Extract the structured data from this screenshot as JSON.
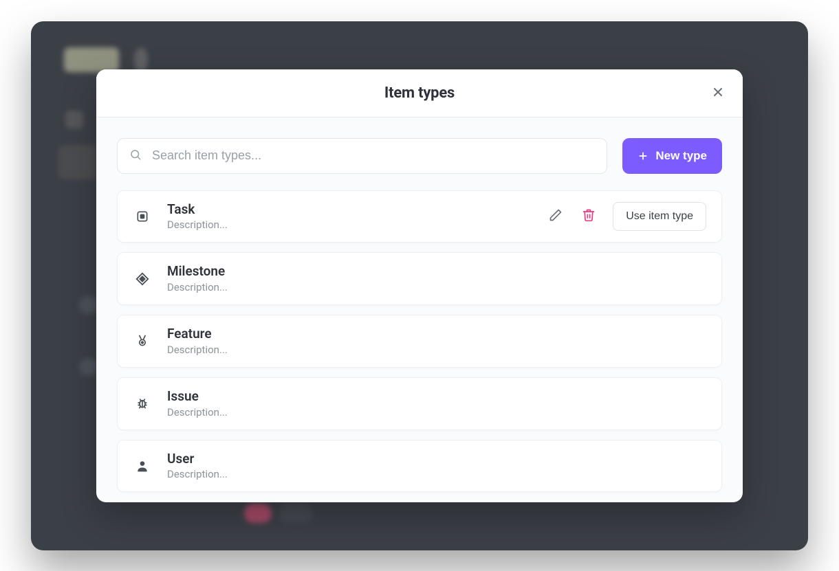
{
  "modal": {
    "title": "Item types",
    "search_placeholder": "Search item types...",
    "new_type_label": "New type",
    "use_label": "Use item type"
  },
  "item_types": [
    {
      "name": "Task",
      "desc": "Description...",
      "icon": "square",
      "hovered": true
    },
    {
      "name": "Milestone",
      "desc": "Description...",
      "icon": "diamond",
      "hovered": false
    },
    {
      "name": "Feature",
      "desc": "Description...",
      "icon": "medal",
      "hovered": false
    },
    {
      "name": "Issue",
      "desc": "Description...",
      "icon": "bug",
      "hovered": false
    },
    {
      "name": "User",
      "desc": "Description...",
      "icon": "user",
      "hovered": false
    }
  ],
  "colors": {
    "accent": "#7c5cff",
    "danger": "#ea3a83"
  }
}
